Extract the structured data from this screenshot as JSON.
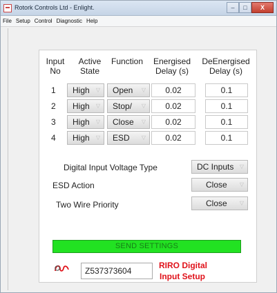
{
  "window": {
    "title": "Rotork Controls Ltd - Enlight.",
    "controls": {
      "minimize": "–",
      "maximize": "□",
      "close": "X"
    }
  },
  "menu": [
    "File",
    "Setup",
    "Control",
    "Diagnostic",
    "Help"
  ],
  "headers": {
    "input": "Input",
    "no": "No",
    "active": "Active",
    "state": "State",
    "function": "Function",
    "energised": "Energised",
    "energised_unit": "Delay (s)",
    "deenergised": "DeEnergised",
    "deenergised_unit": "Delay (s)"
  },
  "rows": [
    {
      "no": "1",
      "state": "High",
      "function": "Open",
      "energised": "0.02",
      "deenergised": "0.1"
    },
    {
      "no": "2",
      "state": "High",
      "function": "Stop/",
      "energised": "0.02",
      "deenergised": "0.1"
    },
    {
      "no": "3",
      "state": "High",
      "function": "Close",
      "energised": "0.02",
      "deenergised": "0.1"
    },
    {
      "no": "4",
      "state": "High",
      "function": "ESD",
      "energised": "0.02",
      "deenergised": "0.1"
    }
  ],
  "settings": {
    "voltage_label": "Digital Input Voltage Type",
    "voltage_value": "DC Inputs",
    "esd_label": "ESD Action",
    "esd_value": "Close",
    "twowire_label": "Two Wire Priority",
    "twowire_value": "Close"
  },
  "send_button": "SEND SETTINGS",
  "serial": "Z537373604",
  "page_title_line1": "RIRO Digital",
  "page_title_line2": "Input Setup",
  "icons": {
    "app": "app-icon",
    "logo": "rotork-logo-icon",
    "dropdown": "chevron-down-icon"
  },
  "colors": {
    "send_button": "#22e222",
    "title_red": "#e0121a"
  }
}
